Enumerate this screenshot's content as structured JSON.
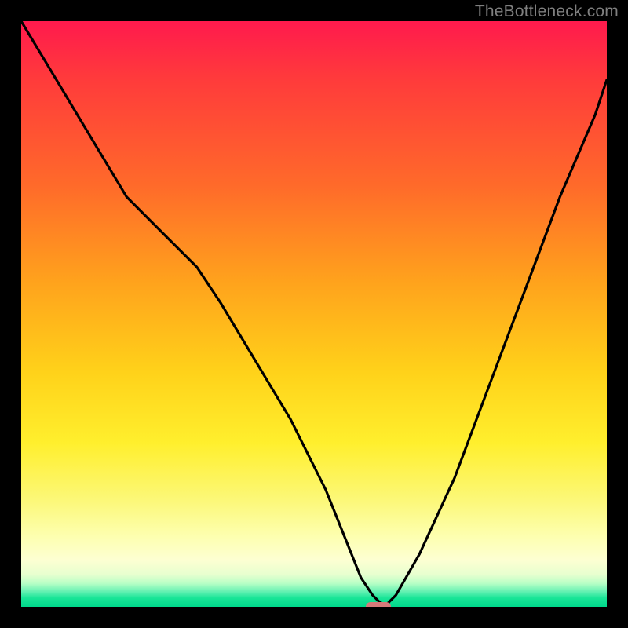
{
  "watermark": "TheBottleneck.com",
  "colors": {
    "frame": "#000000",
    "curve_stroke": "#000000",
    "marker_fill": "#d67a7a",
    "gradient_stops": [
      "#ff1a4d",
      "#ff3b3b",
      "#ff6a2a",
      "#ffa41c",
      "#ffd21a",
      "#ffef2d",
      "#fcf87a",
      "#fdffb0",
      "#fdffd2",
      "#e7ffcf",
      "#b8ffc6",
      "#5ef0b0",
      "#19e597",
      "#00d98c"
    ]
  },
  "chart_data": {
    "type": "line",
    "title": "",
    "xlabel": "",
    "ylabel": "",
    "xlim": [
      0,
      100
    ],
    "ylim": [
      0,
      100
    ],
    "grid": false,
    "legend": false,
    "series": [
      {
        "name": "bottleneck-curve",
        "x": [
          0,
          6,
          12,
          18,
          24,
          30,
          34,
          40,
          46,
          52,
          56,
          58,
          60,
          62,
          64,
          68,
          74,
          80,
          86,
          92,
          98,
          100
        ],
        "y": [
          100,
          90,
          80,
          70,
          64,
          58,
          52,
          42,
          32,
          20,
          10,
          5,
          2,
          0,
          2,
          9,
          22,
          38,
          54,
          70,
          84,
          90
        ]
      }
    ],
    "marker": {
      "x": 61,
      "y": 0,
      "width_pct": 4.3,
      "height_pct": 1.6
    }
  }
}
